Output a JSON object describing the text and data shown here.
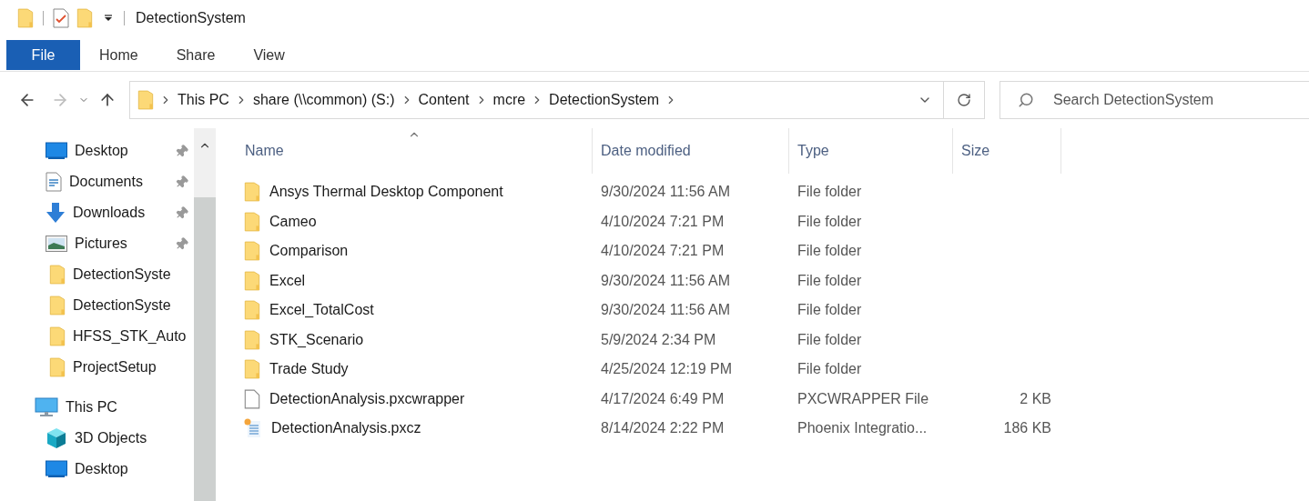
{
  "window": {
    "title": "DetectionSystem"
  },
  "ribbon_tabs": [
    {
      "label": "File",
      "selected": true
    },
    {
      "label": "Home",
      "selected": false
    },
    {
      "label": "Share",
      "selected": false
    },
    {
      "label": "View",
      "selected": false
    }
  ],
  "address": {
    "crumbs": [
      "This PC",
      "share (\\\\common) (S:)",
      "Content",
      "mcre",
      "DetectionSystem"
    ]
  },
  "search": {
    "placeholder": "Search DetectionSystem"
  },
  "sidebar": {
    "items": [
      {
        "label": "Desktop",
        "kind": "desktop",
        "pinned": true
      },
      {
        "label": "Documents",
        "kind": "documents",
        "pinned": true
      },
      {
        "label": "Downloads",
        "kind": "downloads",
        "pinned": true
      },
      {
        "label": "Pictures",
        "kind": "pictures",
        "pinned": true
      },
      {
        "label": "DetectionSyste",
        "kind": "folder",
        "pinned": false
      },
      {
        "label": "DetectionSyste",
        "kind": "folder",
        "pinned": false
      },
      {
        "label": "HFSS_STK_Auto",
        "kind": "folder",
        "pinned": false
      },
      {
        "label": "ProjectSetup",
        "kind": "folder",
        "pinned": false
      },
      {
        "label": "This PC",
        "kind": "pc",
        "pinned": false
      },
      {
        "label": "3D Objects",
        "kind": "cube",
        "pinned": false
      },
      {
        "label": "Desktop",
        "kind": "desktop",
        "pinned": false
      }
    ]
  },
  "table": {
    "columns": [
      {
        "label": "Name",
        "sorted": true
      },
      {
        "label": "Date modified",
        "sorted": false
      },
      {
        "label": "Type",
        "sorted": false
      },
      {
        "label": "Size",
        "sorted": false
      }
    ],
    "rows": [
      {
        "kind": "folder",
        "name": "Ansys Thermal Desktop Component",
        "date": "9/30/2024 11:56 AM",
        "type": "File folder"
      },
      {
        "kind": "folder",
        "name": "Cameo",
        "date": "4/10/2024 7:21 PM",
        "type": "File folder"
      },
      {
        "kind": "folder",
        "name": "Comparison",
        "date": "4/10/2024 7:21 PM",
        "type": "File folder"
      },
      {
        "kind": "folder",
        "name": "Excel",
        "date": "9/30/2024 11:56 AM",
        "type": "File folder"
      },
      {
        "kind": "folder",
        "name": "Excel_TotalCost",
        "date": "9/30/2024 11:56 AM",
        "type": "File folder"
      },
      {
        "kind": "folder",
        "name": "STK_Scenario",
        "date": "5/9/2024 2:34 PM",
        "type": "File folder"
      },
      {
        "kind": "folder",
        "name": "Trade Study",
        "date": "4/25/2024 12:19 PM",
        "type": "File folder"
      },
      {
        "kind": "file",
        "name": "DetectionAnalysis.pxcwrapper",
        "date": "4/17/2024 6:49 PM",
        "type": "PXCWRAPPER File",
        "size": "2 KB"
      },
      {
        "kind": "document",
        "name": "DetectionAnalysis.pxcz",
        "date": "8/14/2024 2:22 PM",
        "type": "Phoenix Integratio...",
        "size": "186 KB"
      }
    ]
  }
}
